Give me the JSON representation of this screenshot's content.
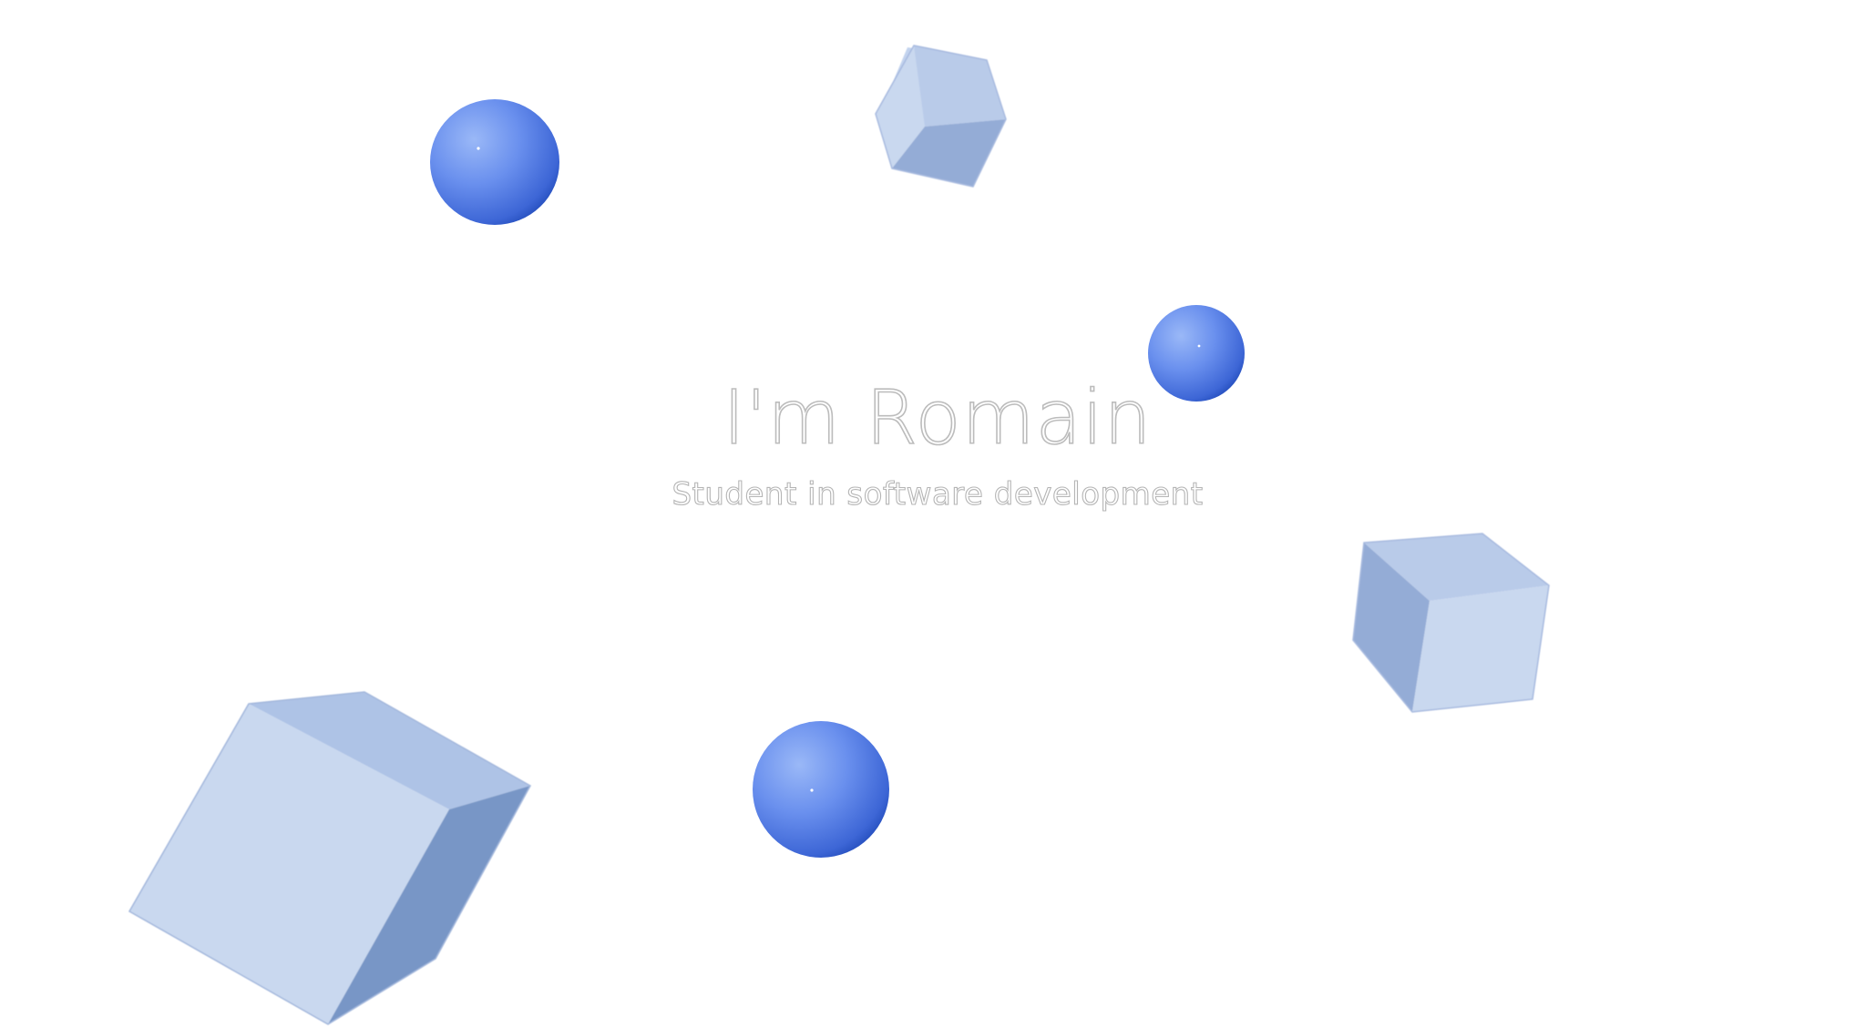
{
  "hero": {
    "title": "I'm Romain",
    "subtitle": "Student in software development"
  },
  "scene": {
    "shapes": [
      "sphere",
      "cube",
      "sphere",
      "cube",
      "cube",
      "sphere"
    ]
  },
  "colors": {
    "background": "#ffffff",
    "sphere_light": "#8fb0f5",
    "sphere_mid": "#5d86ea",
    "sphere_dark": "#1f49b8",
    "cube_top": "#b9cbe9",
    "cube_left": "#c9d8ef",
    "cube_right": "#94acd6",
    "text_outline": "#bcbcbc"
  }
}
